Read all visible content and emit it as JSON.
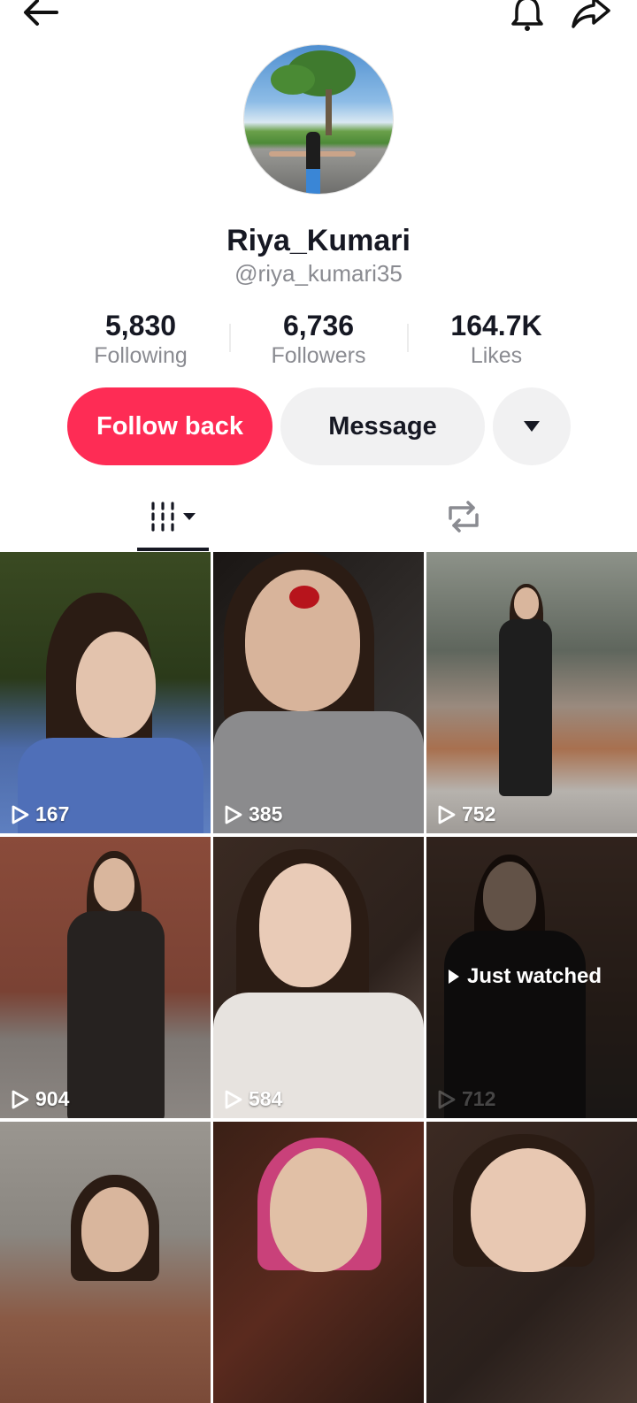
{
  "topbar": {
    "back_icon": "arrow-left-icon",
    "bell_icon": "bell-icon",
    "share_icon": "share-arrow-icon"
  },
  "profile": {
    "display_name": "Riya_Kumari",
    "username": "@riya_kumari35",
    "stats": [
      {
        "value": "5,830",
        "label": "Following"
      },
      {
        "value": "6,736",
        "label": "Followers"
      },
      {
        "value": "164.7K",
        "label": "Likes"
      }
    ]
  },
  "actions": {
    "follow_label": "Follow back",
    "message_label": "Message",
    "more_icon": "caret-down-icon"
  },
  "tabs": {
    "videos_icon": "videos-grid-icon",
    "reposts_icon": "repost-icon",
    "active": "videos"
  },
  "videos": [
    {
      "views": "167"
    },
    {
      "views": "385"
    },
    {
      "views": "752"
    },
    {
      "views": "904"
    },
    {
      "views": "584"
    },
    {
      "views": "712",
      "overlay": "Just watched"
    },
    {
      "views": ""
    },
    {
      "views": ""
    },
    {
      "views": ""
    }
  ],
  "colors": {
    "accent": "#fe2c55",
    "secondary_btn": "#f1f1f2",
    "muted_text": "#8a8b91"
  }
}
